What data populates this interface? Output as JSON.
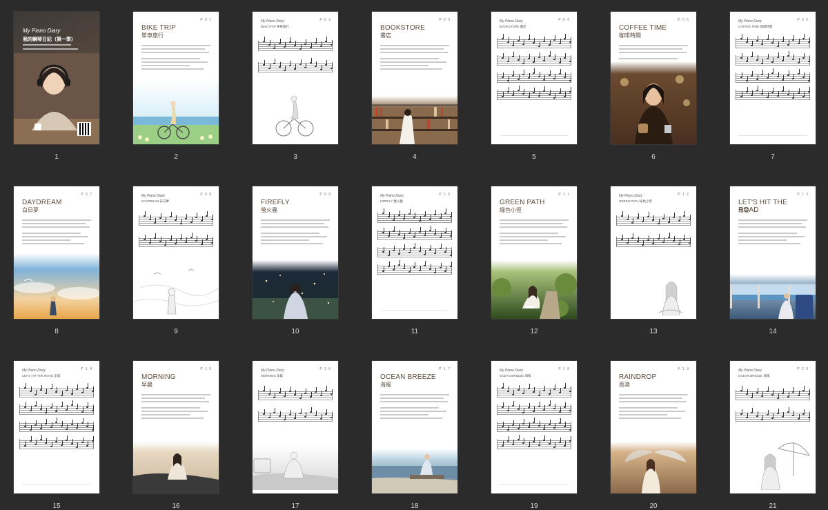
{
  "cover": {
    "title": "My Piano Diary",
    "subtitle": "我的鋼琴日記（第一季）",
    "page_number": "1"
  },
  "pages": [
    {
      "n": "2",
      "code": "P 0 1",
      "kind": "text",
      "title": "BIKE TRIP",
      "sub": "單車旅行",
      "scene": "bike",
      "bg": "#dff2fb",
      "fg": "#f3d8a0"
    },
    {
      "n": "3",
      "code": "P 0 2",
      "kind": "score",
      "head": "My Piano Diary",
      "sub": "BIKE TRIP 單車旅行",
      "staves": 2,
      "scene": "bike-sketch"
    },
    {
      "n": "4",
      "code": "P 0 3",
      "kind": "text",
      "title": "BOOKSTORE",
      "sub": "書店",
      "scene": "bookstore",
      "bg": "#8a6a4c",
      "fg": "#3d2c1d"
    },
    {
      "n": "5",
      "code": "P 0 4",
      "kind": "score",
      "head": "My Piano Diary",
      "sub": "BOOKSTORE 書店",
      "staves": 4,
      "scene": "none"
    },
    {
      "n": "6",
      "code": "P 0 5",
      "kind": "text",
      "title": "COFFEE TIME",
      "sub": "咖啡時間",
      "scene": "coffee",
      "bg": "#6b4a2f",
      "fg": "#2b1c12"
    },
    {
      "n": "7",
      "code": "P 0 6",
      "kind": "score",
      "head": "My Piano Diary",
      "sub": "COFFEE TIME 咖啡時間",
      "staves": 4,
      "scene": "none"
    },
    {
      "n": "8",
      "code": "P 0 7",
      "kind": "text",
      "title": "DAYDREAM",
      "sub": "白日夢",
      "scene": "daydream",
      "bg": "#7fb2d9",
      "fg": "#e8a64a"
    },
    {
      "n": "9",
      "code": "P 0 8",
      "kind": "score",
      "head": "My Piano Diary",
      "sub": "DAYDREAM 白日夢",
      "staves": 2,
      "scene": "daydream-sketch"
    },
    {
      "n": "10",
      "code": "P 0 9",
      "kind": "text",
      "title": "FIREFLY",
      "sub": "螢火蟲",
      "scene": "firefly",
      "bg": "#1d2a3a",
      "fg": "#5d7a5a"
    },
    {
      "n": "11",
      "code": "P 1 0",
      "kind": "score",
      "head": "My Piano Diary",
      "sub": "FIREFLY 螢火蟲",
      "staves": 4,
      "scene": "none"
    },
    {
      "n": "12",
      "code": "P 1 1",
      "kind": "text",
      "title": "GREEN PATH",
      "sub": "綠色小徑",
      "scene": "greenpath",
      "bg": "#6a8a3c",
      "fg": "#2f4a1e"
    },
    {
      "n": "13",
      "code": "P 1 2",
      "kind": "score",
      "head": "My Piano Diary",
      "sub": "GREEN PATH 綠色小徑",
      "staves": 2,
      "scene": "greenpath-sketch"
    },
    {
      "n": "14",
      "code": "P 1 3",
      "kind": "text",
      "title": "LET'S HIT THE ROAD",
      "sub": "出發",
      "scene": "train",
      "bg": "#9fb9cf",
      "fg": "#3e5a7a"
    },
    {
      "n": "15",
      "code": "P 1 4",
      "kind": "score",
      "head": "My Piano Diary",
      "sub": "LET'S HIT THE ROAD 出發",
      "staves": 4,
      "scene": "none"
    },
    {
      "n": "16",
      "code": "P 1 5",
      "kind": "text",
      "title": "MORNING",
      "sub": "早晨",
      "scene": "morning",
      "bg": "#c9b49a",
      "fg": "#3a3a3a"
    },
    {
      "n": "17",
      "code": "P 1 6",
      "kind": "score",
      "head": "My Piano Diary",
      "sub": "MORNING 早晨",
      "staves": 2,
      "scene": "morning-sketch"
    },
    {
      "n": "18",
      "code": "P 1 7",
      "kind": "text",
      "title": "OCEAN BREEZE",
      "sub": "海風",
      "scene": "ocean",
      "bg": "#b9d3e3",
      "fg": "#4a6070"
    },
    {
      "n": "19",
      "code": "P 1 8",
      "kind": "score",
      "head": "My Piano Diary",
      "sub": "OCEAN BREEZE 海風",
      "staves": 4,
      "scene": "none"
    },
    {
      "n": "20",
      "code": "P 1 9",
      "kind": "text",
      "title": "RAINDROP",
      "sub": "雨滴",
      "scene": "rain",
      "bg": "#d7b48a",
      "fg": "#a57a55"
    },
    {
      "n": "21",
      "code": "P 2 0",
      "kind": "score",
      "head": "My Piano Diary",
      "sub": "OCEAN BREEZE 海風",
      "staves": 2,
      "scene": "rain-sketch"
    }
  ]
}
